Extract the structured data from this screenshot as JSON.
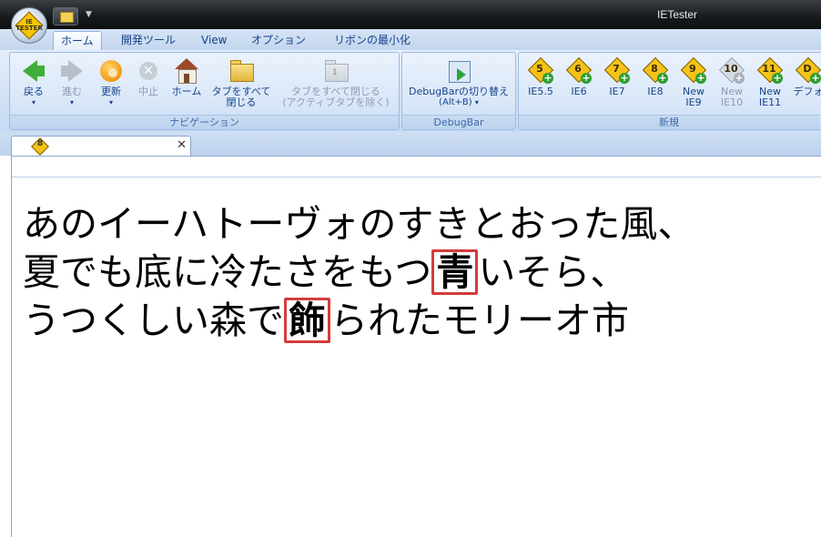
{
  "window": {
    "title": "IETester",
    "app_logo_text": "IE TESTER"
  },
  "ribbon_tabs": [
    {
      "label": "ホーム",
      "active": true
    },
    {
      "label": "開発ツール",
      "active": false
    },
    {
      "label": "View",
      "active": false
    },
    {
      "label": "オプション",
      "active": false
    },
    {
      "label": "リボンの最小化",
      "active": false
    }
  ],
  "groups": {
    "navigation": {
      "label": "ナビゲーション",
      "buttons": {
        "back": "戻る",
        "forward": "進む",
        "refresh": "更新",
        "stop": "中止",
        "home": "ホーム",
        "close_all_1": "タブをすべて",
        "close_all_2": "閉じる",
        "close_all_except_1": "タブをすべて閉じる",
        "close_all_except_2": "(アクティブタブを除く)",
        "close_all_except_badge": "1"
      }
    },
    "debugbar": {
      "label": "DebugBar",
      "toggle_1": "DebugBarの切り替え",
      "toggle_2": "(Alt+B)"
    },
    "new": {
      "label": "新規",
      "items": [
        {
          "num": "5",
          "line1": "IE5.5",
          "line2": "",
          "enabled": true
        },
        {
          "num": "6",
          "line1": "IE6",
          "line2": "",
          "enabled": true
        },
        {
          "num": "7",
          "line1": "IE7",
          "line2": "",
          "enabled": true
        },
        {
          "num": "8",
          "line1": "IE8",
          "line2": "",
          "enabled": true
        },
        {
          "num": "9",
          "line1": "New",
          "line2": "IE9",
          "enabled": true
        },
        {
          "num": "10",
          "line1": "New",
          "line2": "IE10",
          "enabled": false
        },
        {
          "num": "11",
          "line1": "New",
          "line2": "IE11",
          "enabled": true
        },
        {
          "num": "D",
          "line1": "デフォ",
          "line2": "",
          "enabled": true
        }
      ]
    }
  },
  "document_tab": {
    "icon_num": "8",
    "title": ""
  },
  "page": {
    "line1": "あのイーハトーヴォのすきとおった風、",
    "line2_a": "夏でも底に冷たさをもつ",
    "line2_hl": "青",
    "line2_b": "いそら、",
    "line3_a": "うつくしい森で",
    "line3_hl": "飾",
    "line3_b": "られたモリーオ市"
  },
  "colors": {
    "highlight_box": "#d43c3c",
    "ribbon_text": "#15428b"
  }
}
